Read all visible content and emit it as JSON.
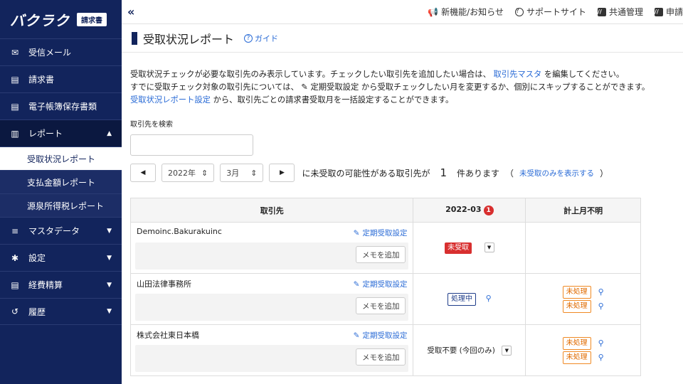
{
  "brand": {
    "logo": "バクラク",
    "badge": "請求書"
  },
  "sidebar": {
    "items": [
      {
        "label": "受信メール",
        "icon": "mail-icon"
      },
      {
        "label": "請求書",
        "icon": "document-icon"
      },
      {
        "label": "電子帳簿保存書類",
        "icon": "document-icon"
      },
      {
        "label": "レポート",
        "icon": "chart-icon"
      },
      {
        "label": "マスタデータ",
        "icon": "database-icon"
      },
      {
        "label": "設定",
        "icon": "gear-icon"
      },
      {
        "label": "経費精算",
        "icon": "document-icon"
      },
      {
        "label": "履歴",
        "icon": "history-icon"
      }
    ],
    "report_sub": [
      "受取状況レポート",
      "支払金額レポート",
      "源泉所得税レポート"
    ]
  },
  "topbar": {
    "news": "新機能/お知らせ",
    "support": "サポートサイト",
    "common": "共通管理",
    "apply": "申請"
  },
  "page": {
    "title": "受取状況レポート",
    "guide": "ガイド",
    "desc1_a": "受取状況チェックが必要な取引先のみ表示しています。チェックしたい取引先を追加したい場合は、",
    "desc1_link": "取引先マスタ",
    "desc1_b": "を編集してください。",
    "desc2_a": "すでに受取チェック対象の取引先については、",
    "desc2_b": "定期受取設定",
    "desc2_c": "から受取チェックしたい月を変更するか、個別にスキップすることができます。",
    "desc3_link": "受取状況レポート設定",
    "desc3_b": "から、取引先ごとの請求書受取月を一括設定することができます。",
    "search_label": "取引先を検索"
  },
  "filter": {
    "year": "2022年",
    "month": "3月",
    "text_a": "に未受取の可能性がある取引先が",
    "count": "1",
    "text_b": "件あります",
    "paren_open": "（",
    "link": "未受取のみを表示する",
    "paren_close": "）"
  },
  "table": {
    "headers": {
      "company": "取引先",
      "month": "2022-03",
      "month_count": "1",
      "unknown": "計上月不明"
    },
    "teiki_label": "定期受取設定",
    "memo_label": "メモを追加",
    "rows": [
      {
        "name": "Demoinc.Bakurakuinc",
        "status": "未受取",
        "right1": "",
        "right2": ""
      },
      {
        "name": "山田法律事務所",
        "status": "処理中",
        "right1": "未処理",
        "right2": "未処理"
      },
      {
        "name": "株式会社東日本橋",
        "status": "受取不要 (今回のみ)",
        "right1": "未処理",
        "right2": "未処理"
      }
    ]
  }
}
